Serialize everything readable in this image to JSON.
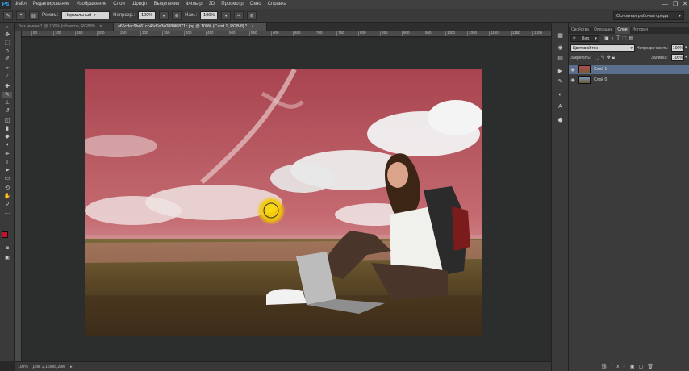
{
  "menubar": {
    "logo": "Ps",
    "items": [
      "Файл",
      "Редактирование",
      "Изображение",
      "Слои",
      "Шрифт",
      "Выделение",
      "Фильтр",
      "3D",
      "Просмотр",
      "Окно",
      "Справка"
    ],
    "minimize": "—",
    "maximize": "❐",
    "close": "✕"
  },
  "options": {
    "mode_label": "Режим:",
    "mode_value": "Нормальный",
    "opacity_label": "Непрозр.:",
    "opacity_value": "100%",
    "pressure_label": "Наж.:",
    "pressure_value": "100%",
    "workspace": "Основная рабочая среда"
  },
  "tabs": [
    {
      "label": "Без имени-1 @ 100% (объекты, RGB/8)",
      "close": "×"
    },
    {
      "label": "a65cdac9b461cc45d6a3e0884f6871c.jpg @ 100% (Слой 1, RGB/8) *",
      "close": "×"
    }
  ],
  "ruler": [
    "50",
    "100",
    "150",
    "200",
    "250",
    "300",
    "350",
    "400",
    "450",
    "500",
    "550",
    "600",
    "650",
    "700",
    "750",
    "800",
    "850",
    "900",
    "950",
    "1000",
    "1050",
    "1100",
    "1150",
    "1200"
  ],
  "status": {
    "zoom": "100%",
    "doc": "Док: 2,16М/8,28М"
  },
  "panels": {
    "tabs": [
      "Свойства",
      "Операции",
      "Слои",
      "История"
    ],
    "kind_label": "Вид",
    "blend_mode": "Цветовой тон",
    "opacity_label": "Непрозрачность:",
    "opacity_value": "100%",
    "lock_label": "Закрепить:",
    "fill_label": "Заливка:",
    "fill_value": "100%",
    "layers": [
      {
        "name": "Слой 1",
        "selected": true
      },
      {
        "name": "Слой 0",
        "selected": false
      }
    ]
  },
  "colors": {
    "accent": "#31a8ff",
    "foreground": "#c8102e",
    "background": "#ffffff",
    "selected_layer": "#5a6f8c"
  }
}
